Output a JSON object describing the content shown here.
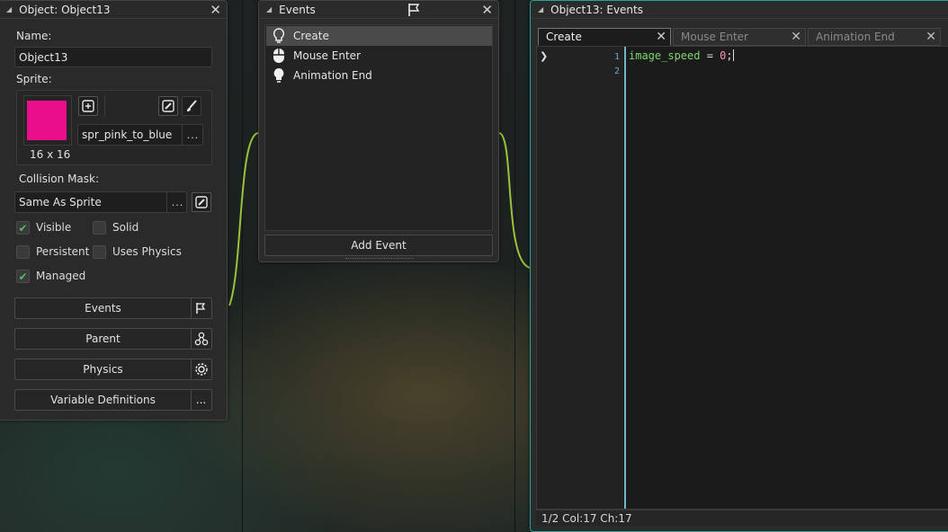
{
  "object_window": {
    "title": "Object: Object13",
    "name_label": "Name:",
    "name_value": "Object13",
    "sprite_label": "Sprite:",
    "sprite_name": "spr_pink_to_blue",
    "sprite_size": "16 x 16",
    "sprite_color": "#ea0d8c",
    "collision_label": "Collision Mask:",
    "collision_value": "Same As Sprite",
    "more_label": "...",
    "checkboxes": [
      {
        "label": "Visible",
        "checked": true
      },
      {
        "label": "Solid",
        "checked": false
      },
      {
        "label": "Persistent",
        "checked": false
      },
      {
        "label": "Uses Physics",
        "checked": false
      },
      {
        "label": "Managed",
        "checked": true
      }
    ],
    "buttons": [
      {
        "label": "Events",
        "icon": "flag-icon"
      },
      {
        "label": "Parent",
        "icon": "hierarchy-icon"
      },
      {
        "label": "Physics",
        "icon": "gear-icon"
      },
      {
        "label": "Variable Definitions",
        "icon": "more-icon"
      }
    ]
  },
  "events_window": {
    "title": "Events",
    "events": [
      {
        "label": "Create",
        "icon": "bulb-icon",
        "selected": true
      },
      {
        "label": "Mouse Enter",
        "icon": "mouse-icon",
        "selected": false
      },
      {
        "label": "Animation End",
        "icon": "bulb-icon",
        "selected": false
      }
    ],
    "add_event_label": "Add Event"
  },
  "code_window": {
    "title": "Object13: Events",
    "tabs": [
      {
        "label": "Create",
        "active": true
      },
      {
        "label": "Mouse Enter",
        "active": false
      },
      {
        "label": "Animation End",
        "active": false
      }
    ],
    "line_numbers": [
      "1",
      "2"
    ],
    "code": {
      "identifier": "image_speed",
      "operator": " = ",
      "number": "0",
      "terminator": ";"
    },
    "status": "1/2 Col:17 Ch:17"
  },
  "colors": {
    "accent": "#1fa596",
    "check_green": "#4fbf5b",
    "code_green": "#7fd470"
  }
}
